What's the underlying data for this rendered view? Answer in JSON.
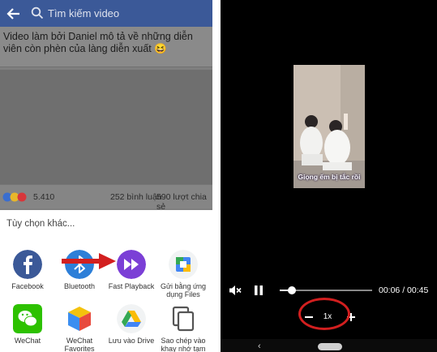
{
  "left": {
    "search": {
      "placeholder": "Tìm kiếm video"
    },
    "post": {
      "title": "Video làm bởi Daniel mô tả về những diễn viên còn phèn của làng diễn xuất 😆",
      "reaction_count": "5.410",
      "comments": "252 bình luận",
      "shares": "590 lượt chia sẻ"
    },
    "share_sheet": {
      "title": "Tùy chọn khác...",
      "apps": [
        {
          "label": "Facebook",
          "icon": "facebook-icon"
        },
        {
          "label": "Bluetooth",
          "icon": "bluetooth-icon"
        },
        {
          "label": "Fast Playback",
          "icon": "fast-forward-icon"
        },
        {
          "label": "Gửi bằng ứng dụng Files",
          "icon": "files-icon"
        },
        {
          "label": "WeChat",
          "icon": "wechat-icon"
        },
        {
          "label": "WeChat Favorites",
          "icon": "cube-icon"
        },
        {
          "label": "Lưu vào Drive",
          "icon": "drive-icon"
        },
        {
          "label": "Sao chép vào khay nhớ tạm",
          "icon": "copy-icon"
        }
      ]
    }
  },
  "right": {
    "video": {
      "caption": "Giọng ếm bị tắc rồi"
    },
    "player": {
      "elapsed": "00:06",
      "duration": "00:45",
      "time_display": "00:06 / 00:45",
      "progress": 0.13,
      "speed": "1x"
    }
  },
  "colors": {
    "facebook_blue": "#3b5998",
    "annotation_red": "#d21f1f",
    "fast_playback_purple": "#7b3fd6"
  }
}
